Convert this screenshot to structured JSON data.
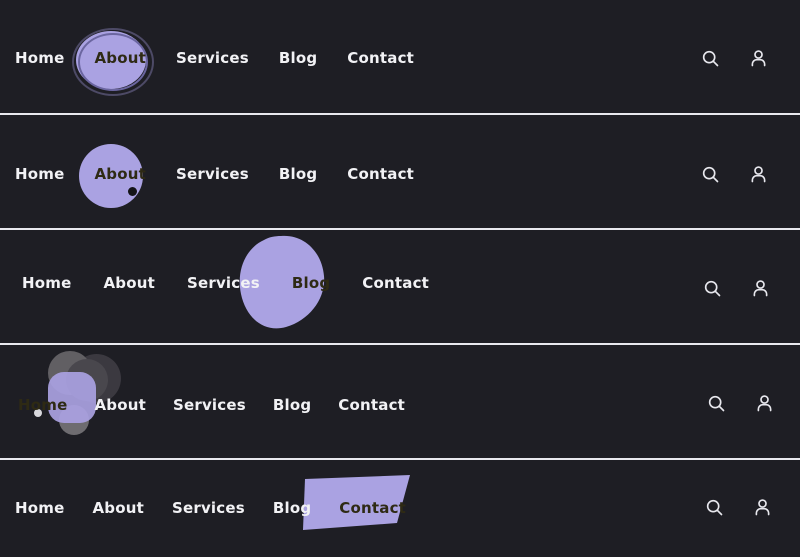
{
  "theme": {
    "background": "#1e1e24",
    "divider": "#e9e9ee",
    "link_color": "#f2f2f5",
    "active_link_color": "#2e2a14",
    "highlight_purple": "#aaa2e2",
    "ring_stroke": "#4d4a66",
    "gray_1": "#615f63",
    "gray_2": "#49474d",
    "gray_3": "#3b3940",
    "gray_4": "#8d8b8e",
    "dot_dark": "#141418",
    "dot_light": "#d8d8dd",
    "icon_color": "#e8e8ee"
  },
  "icons": {
    "search": "search-icon",
    "account": "user-account-icon"
  },
  "navbars": [
    {
      "id": "navbar-1",
      "active": "About",
      "highlight_style": "ring-circle",
      "links": [
        "Home",
        "About",
        "Services",
        "Blog",
        "Contact"
      ],
      "actions": [
        "search-icon",
        "user-account-icon"
      ]
    },
    {
      "id": "navbar-2",
      "active": "About",
      "highlight_style": "solid-circle-with-dot",
      "links": [
        "Home",
        "About",
        "Services",
        "Blog",
        "Contact"
      ],
      "actions": [
        "search-icon",
        "user-account-icon"
      ]
    },
    {
      "id": "navbar-3",
      "active": "Blog",
      "highlight_style": "organic-blob",
      "links": [
        "Home",
        "About",
        "Services",
        "Blog",
        "Contact"
      ],
      "actions": [
        "search-icon",
        "user-account-icon"
      ]
    },
    {
      "id": "navbar-4",
      "active": "Home",
      "highlight_style": "cluster-rounded-square",
      "links": [
        "Home",
        "About",
        "Services",
        "Blog",
        "Contact"
      ],
      "actions": [
        "search-icon",
        "user-account-icon"
      ]
    },
    {
      "id": "navbar-5",
      "active": "Contact",
      "highlight_style": "angled-quadrilateral",
      "links": [
        "Home",
        "About",
        "Services",
        "Blog",
        "Contact"
      ],
      "actions": [
        "search-icon",
        "user-account-icon"
      ]
    }
  ]
}
